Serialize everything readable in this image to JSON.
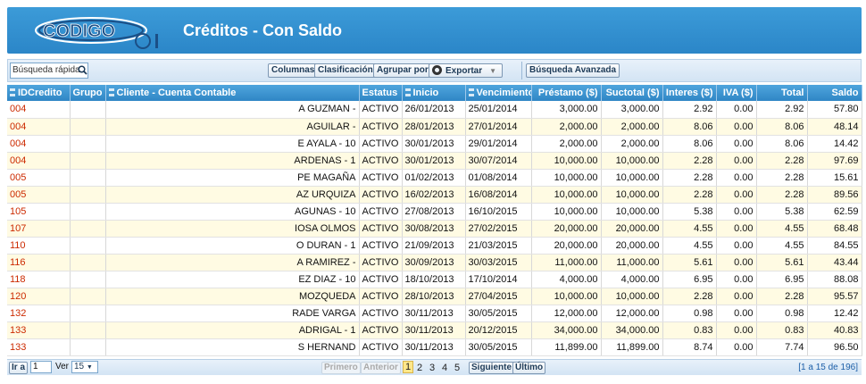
{
  "header": {
    "logo_text": "CODIGO01",
    "title": "Créditos - Con Saldo"
  },
  "toolbar": {
    "search_placeholder": "Búsqueda rápida",
    "columns_label": "Columnas",
    "sort_label": "Clasificación",
    "group_label": "Agrupar por",
    "export_label": "Exportar",
    "advanced_search_label": "Búsqueda Avanzada"
  },
  "columns": [
    "IDCredito",
    "Grupo",
    "Cliente - Cuenta Contable",
    "Estatus",
    "Inicio",
    "Vencimiento",
    "Préstamo ($)",
    "Suctotal ($)",
    "Interes ($)",
    "IVA ($)",
    "Total",
    "Saldo"
  ],
  "rows": [
    {
      "id": "004",
      "cliente": "A GUZMAN -",
      "estatus": "ACTIVO",
      "inicio": "26/01/2013",
      "venc": "25/01/2014",
      "prestamo": "3,000.00",
      "subtotal": "3,000.00",
      "interes": "2.92",
      "iva": "0.00",
      "total": "2.92",
      "saldo": "57.80"
    },
    {
      "id": "004",
      "cliente": "AGUILAR -",
      "estatus": "ACTIVO",
      "inicio": "28/01/2013",
      "venc": "27/01/2014",
      "prestamo": "2,000.00",
      "subtotal": "2,000.00",
      "interes": "8.06",
      "iva": "0.00",
      "total": "8.06",
      "saldo": "48.14"
    },
    {
      "id": "004",
      "cliente": "E AYALA - 10",
      "estatus": "ACTIVO",
      "inicio": "30/01/2013",
      "venc": "29/01/2014",
      "prestamo": "2,000.00",
      "subtotal": "2,000.00",
      "interes": "8.06",
      "iva": "0.00",
      "total": "8.06",
      "saldo": "14.42"
    },
    {
      "id": "004",
      "cliente": "ARDENAS - 1",
      "estatus": "ACTIVO",
      "inicio": "30/01/2013",
      "venc": "30/07/2014",
      "prestamo": "10,000.00",
      "subtotal": "10,000.00",
      "interes": "2.28",
      "iva": "0.00",
      "total": "2.28",
      "saldo": "97.69"
    },
    {
      "id": "005",
      "cliente": "PE MAGAÑA",
      "estatus": "ACTIVO",
      "inicio": "01/02/2013",
      "venc": "01/08/2014",
      "prestamo": "10,000.00",
      "subtotal": "10,000.00",
      "interes": "2.28",
      "iva": "0.00",
      "total": "2.28",
      "saldo": "15.61"
    },
    {
      "id": "005",
      "cliente": "AZ URQUIZA",
      "estatus": "ACTIVO",
      "inicio": "16/02/2013",
      "venc": "16/08/2014",
      "prestamo": "10,000.00",
      "subtotal": "10,000.00",
      "interes": "2.28",
      "iva": "0.00",
      "total": "2.28",
      "saldo": "89.56"
    },
    {
      "id": "105",
      "cliente": "AGUNAS - 10",
      "estatus": "ACTIVO",
      "inicio": "27/08/2013",
      "venc": "16/10/2015",
      "prestamo": "10,000.00",
      "subtotal": "10,000.00",
      "interes": "5.38",
      "iva": "0.00",
      "total": "5.38",
      "saldo": "62.59"
    },
    {
      "id": "107",
      "cliente": "IOSA OLMOS",
      "estatus": "ACTIVO",
      "inicio": "30/08/2013",
      "venc": "27/02/2015",
      "prestamo": "20,000.00",
      "subtotal": "20,000.00",
      "interes": "4.55",
      "iva": "0.00",
      "total": "4.55",
      "saldo": "68.48"
    },
    {
      "id": "110",
      "cliente": "O DURAN - 1",
      "estatus": "ACTIVO",
      "inicio": "21/09/2013",
      "venc": "21/03/2015",
      "prestamo": "20,000.00",
      "subtotal": "20,000.00",
      "interes": "4.55",
      "iva": "0.00",
      "total": "4.55",
      "saldo": "84.55"
    },
    {
      "id": "116",
      "cliente": "A RAMIREZ -",
      "estatus": "ACTIVO",
      "inicio": "30/09/2013",
      "venc": "30/03/2015",
      "prestamo": "11,000.00",
      "subtotal": "11,000.00",
      "interes": "5.61",
      "iva": "0.00",
      "total": "5.61",
      "saldo": "43.44"
    },
    {
      "id": "118",
      "cliente": "EZ DIAZ - 10",
      "estatus": "ACTIVO",
      "inicio": "18/10/2013",
      "venc": "17/10/2014",
      "prestamo": "4,000.00",
      "subtotal": "4,000.00",
      "interes": "6.95",
      "iva": "0.00",
      "total": "6.95",
      "saldo": "88.08"
    },
    {
      "id": "120",
      "cliente": "MOZQUEDA",
      "estatus": "ACTIVO",
      "inicio": "28/10/2013",
      "venc": "27/04/2015",
      "prestamo": "10,000.00",
      "subtotal": "10,000.00",
      "interes": "2.28",
      "iva": "0.00",
      "total": "2.28",
      "saldo": "95.57"
    },
    {
      "id": "132",
      "cliente": "RADE VARGA",
      "estatus": "ACTIVO",
      "inicio": "30/11/2013",
      "venc": "30/05/2015",
      "prestamo": "12,000.00",
      "subtotal": "12,000.00",
      "interes": "0.98",
      "iva": "0.00",
      "total": "0.98",
      "saldo": "12.42"
    },
    {
      "id": "133",
      "cliente": "ADRIGAL - 1",
      "estatus": "ACTIVO",
      "inicio": "30/11/2013",
      "venc": "20/12/2015",
      "prestamo": "34,000.00",
      "subtotal": "34,000.00",
      "interes": "0.83",
      "iva": "0.00",
      "total": "0.83",
      "saldo": "40.83"
    },
    {
      "id": "133",
      "cliente": "S HERNAND",
      "estatus": "ACTIVO",
      "inicio": "30/11/2013",
      "venc": "30/05/2015",
      "prestamo": "11,899.00",
      "subtotal": "11,899.00",
      "interes": "8.74",
      "iva": "0.00",
      "total": "7.74",
      "saldo": "96.50"
    }
  ],
  "pager": {
    "goto_label": "Ir a",
    "goto_value": "1",
    "view_label": "Ver",
    "page_size": "15",
    "first_label": "Primero",
    "prev_label": "Anterior",
    "pages": [
      "1",
      "2",
      "3",
      "4",
      "5"
    ],
    "next_label": "Siguiente",
    "last_label": "Último",
    "range_text": "[1 a 15 de 196]"
  }
}
